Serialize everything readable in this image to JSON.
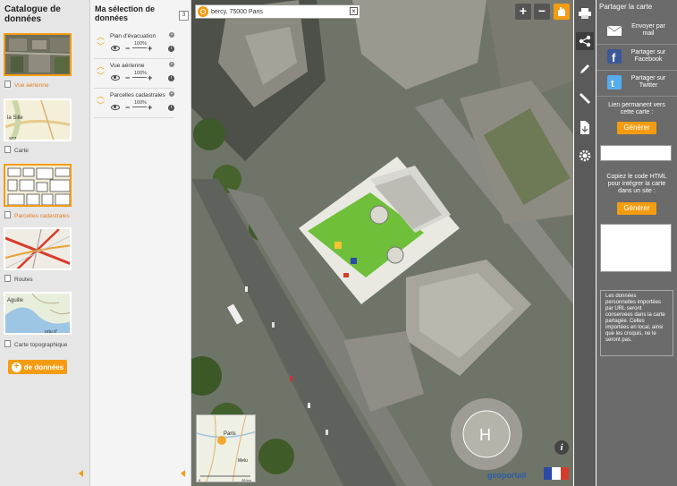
{
  "catalog": {
    "title": "Catalogue de données",
    "items": [
      {
        "label": "Vue aérienne",
        "selected": true
      },
      {
        "label": "Carte",
        "selected": false
      },
      {
        "label": "Parcelles cadastrales",
        "selected": true
      },
      {
        "label": "Routes",
        "selected": false
      },
      {
        "label": "Carte topographique",
        "selected": false
      }
    ],
    "add_button": "de données",
    "thumb_texts": {
      "carte_a": "la Sille",
      "carte_b": "977",
      "topo": "Aguille",
      "topo_b": "ortu d'"
    }
  },
  "selection": {
    "title": "Ma sélection de données",
    "count": "3",
    "layers": [
      {
        "name": "Plan d'évacuation",
        "opacity": "100%"
      },
      {
        "name": "Vue aérienne",
        "opacity": "100%"
      },
      {
        "name": "Parcelles cadastrales",
        "opacity": "100%"
      }
    ]
  },
  "map": {
    "search_value": "bercy, 75000 Paris",
    "zoom_in": "+",
    "zoom_out": "−",
    "minimap": {
      "city": "Paris",
      "city2": "Melu",
      "scale_left": "0",
      "scale_right": "28 km"
    },
    "logo": "geoportail"
  },
  "share": {
    "title": "Partager la carte",
    "email": "Envoyer par mail",
    "facebook": "Partager sur Facebook",
    "twitter": "Partager sur Twitter",
    "permalink_label": "Lien permanent vers cette carte :",
    "generate1": "Générer",
    "embed_label": "Copiez le code HTML pour intégrer la carte dans un site :",
    "generate2": "Générer",
    "disclaimer": "Les données personnelles importées par URL seront conservées dans la carte partagée. Celles importées en local, ainsi que les croquis, ne le seront pas."
  },
  "colors": {
    "accent": "#f39c12",
    "panel_dark": "#6b6b6b",
    "toolbar": "#5a5a5a"
  }
}
